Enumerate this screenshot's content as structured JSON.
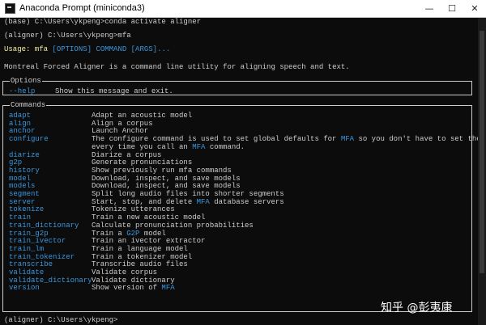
{
  "window": {
    "title": "Anaconda Prompt (miniconda3)",
    "minimize_glyph": "—",
    "maximize_glyph": "☐",
    "close_glyph": "✕"
  },
  "terminal": {
    "line1": "(base) C:\\Users\\ykpeng>conda activate aligner",
    "line2": "(aligner) C:\\Users\\ykpeng>mfa",
    "usage_prefix": "Usage: mfa ",
    "usage_options": "[OPTIONS]",
    "usage_command": "COMMAND",
    "usage_args": "[ARGS]...",
    "intro": "Montreal Forced Aligner is a command line utility for aligning speech and text.",
    "options_title": "Options",
    "options_flag": "--help",
    "options_desc": "Show this message and exit.",
    "commands_title": "Commands",
    "commands": [
      {
        "name": "adapt",
        "desc": "Adapt an acoustic model"
      },
      {
        "name": "align",
        "desc": "Align a corpus"
      },
      {
        "name": "anchor",
        "desc": "Launch Anchor"
      },
      {
        "name": "configure",
        "desc_a": "The configure command is used to set global defaults for ",
        "desc_hl": "MFA",
        "desc_b": " so you don't have to set them"
      },
      {
        "name": "",
        "desc_a": "every time you call an ",
        "desc_hl": "MFA",
        "desc_b": " command."
      },
      {
        "name": "diarize",
        "desc": "Diarize a corpus"
      },
      {
        "name": "g2p",
        "desc": "Generate pronunciations"
      },
      {
        "name": "history",
        "desc": "Show previously run mfa commands"
      },
      {
        "name": "model",
        "desc": "Download, inspect, and save models"
      },
      {
        "name": "models",
        "desc": "Download, inspect, and save models"
      },
      {
        "name": "segment",
        "desc": "Split long audio files into shorter segments"
      },
      {
        "name": "server",
        "desc_a": "Start, stop, and delete ",
        "desc_hl": "MFA",
        "desc_b": " database servers"
      },
      {
        "name": "tokenize",
        "desc": "Tokenize utterances"
      },
      {
        "name": "train",
        "desc": "Train a new acoustic model"
      },
      {
        "name": "train_dictionary",
        "desc": "Calculate pronunciation probabilities"
      },
      {
        "name": "train_g2p",
        "desc_a": "Train a ",
        "desc_hl": "G2P",
        "desc_b": " model"
      },
      {
        "name": "train_ivector",
        "desc": "Train an ivector extractor"
      },
      {
        "name": "train_lm",
        "desc": "Train a language model"
      },
      {
        "name": "train_tokenizer",
        "desc": "Train a tokenizer model"
      },
      {
        "name": "transcribe",
        "desc": "Transcribe audio files"
      },
      {
        "name": "validate",
        "desc": "Validate corpus"
      },
      {
        "name": "validate_dictionary",
        "desc": "Validate dictionary"
      },
      {
        "name": "version",
        "desc_a": "Show version of ",
        "desc_hl": "MFA",
        "desc_b": ""
      }
    ],
    "prompt_last": "(aligner) C:\\Users\\ykpeng>"
  },
  "watermark": "知乎 @彭夷康",
  "colors": {
    "background": "#0c0c0c",
    "text": "#cccccc",
    "command": "#3a96dd",
    "usage": "#f9f1a5"
  }
}
